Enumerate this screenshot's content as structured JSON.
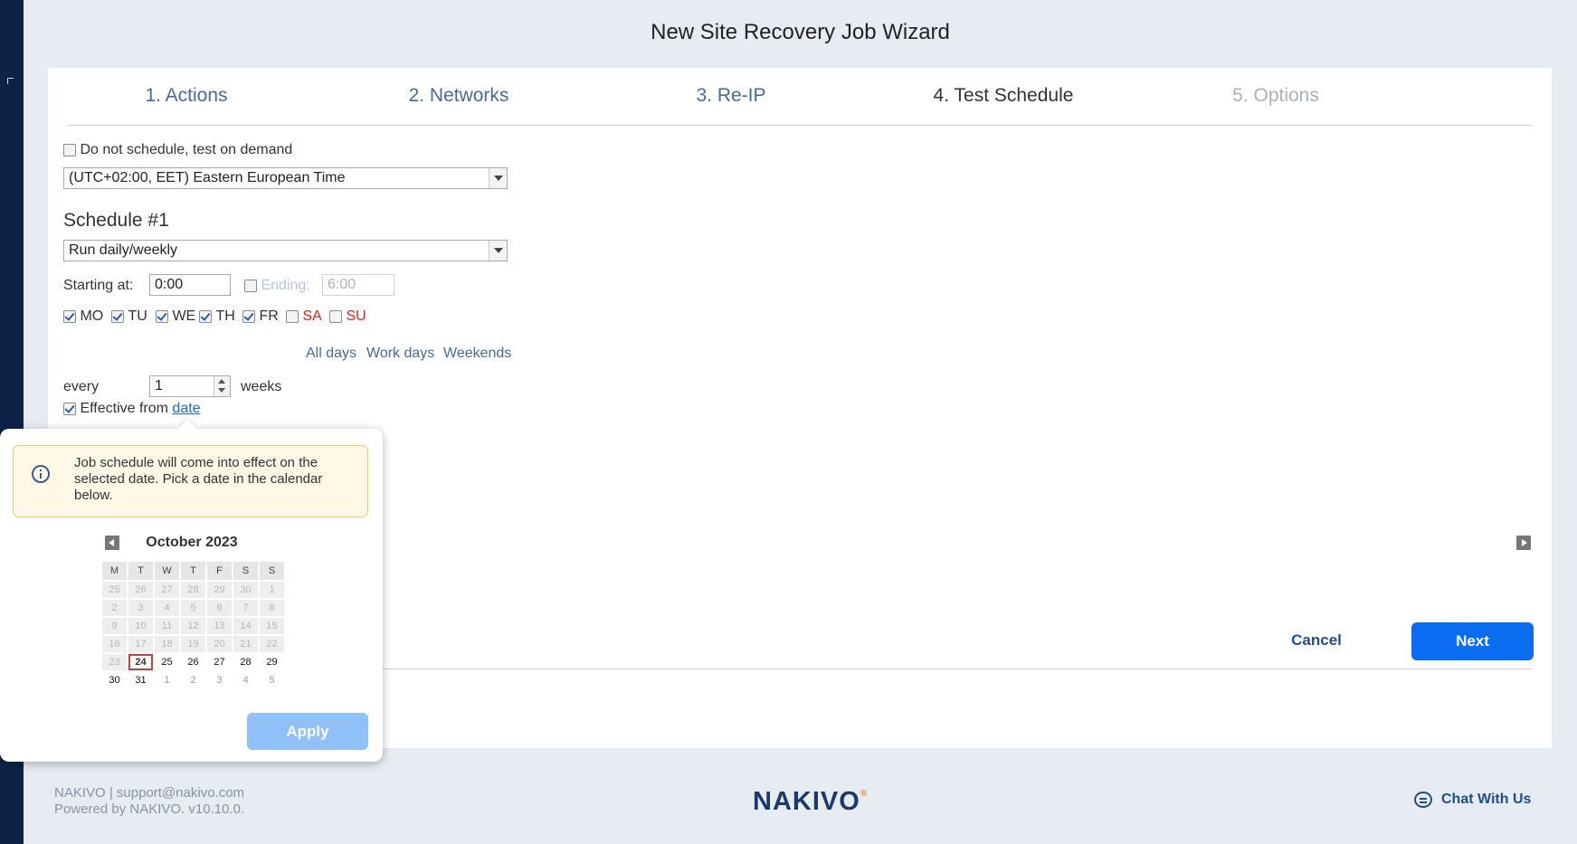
{
  "wizard": {
    "title": "New Site Recovery Job Wizard"
  },
  "steps": [
    {
      "label": "1. Actions",
      "state": "done"
    },
    {
      "label": "2. Networks",
      "state": "done"
    },
    {
      "label": "3. Re-IP",
      "state": "done"
    },
    {
      "label": "4. Test Schedule",
      "state": "active"
    },
    {
      "label": "5. Options",
      "state": "disabled"
    }
  ],
  "form": {
    "no_schedule_label": "Do not schedule, test on demand",
    "no_schedule_checked": false,
    "timezone": "(UTC+02:00, EET) Eastern European Time",
    "schedule_title": "Schedule #1",
    "schedule_type": "Run daily/weekly",
    "starting_label": "Starting at:",
    "starting_value": "0:00",
    "ending_label": "Ending:",
    "ending_value": "6:00",
    "ending_checked": false,
    "days": [
      {
        "label": "MO",
        "checked": true
      },
      {
        "label": "TU",
        "checked": true
      },
      {
        "label": "WE",
        "checked": true
      },
      {
        "label": "TH",
        "checked": true
      },
      {
        "label": "FR",
        "checked": true
      },
      {
        "label": "SA",
        "checked": false
      },
      {
        "label": "SU",
        "checked": false
      }
    ],
    "quick_links": {
      "all": "All days",
      "work": "Work days",
      "weekends": "Weekends"
    },
    "every_label": "every",
    "every_value": "1",
    "weeks_label": "weeks",
    "effective_label": "Effective from",
    "effective_link": "date",
    "effective_checked": true
  },
  "popup": {
    "info_text": "Job schedule will come into effect on the selected date. Pick a date in the calendar below.",
    "month": "October 2023",
    "weekdays": [
      "M",
      "T",
      "W",
      "T",
      "F",
      "S",
      "S"
    ],
    "weeks": [
      [
        "25",
        "26",
        "27",
        "28",
        "29",
        "30",
        "1"
      ],
      [
        "2",
        "3",
        "4",
        "5",
        "6",
        "7",
        "8"
      ],
      [
        "9",
        "10",
        "11",
        "12",
        "13",
        "14",
        "15"
      ],
      [
        "16",
        "17",
        "18",
        "19",
        "20",
        "21",
        "22"
      ],
      [
        "23",
        "24",
        "25",
        "26",
        "27",
        "28",
        "29"
      ],
      [
        "30",
        "31",
        "1",
        "2",
        "3",
        "4",
        "5"
      ]
    ],
    "today": "24",
    "apply_label": "Apply"
  },
  "actions": {
    "cancel": "Cancel",
    "next": "Next"
  },
  "footer": {
    "line1": "NAKIVO | support@nakivo.com",
    "line2": "Powered by NAKIVO. v10.10.0.",
    "logo": "NAKIVO",
    "logo_mark": "®",
    "chat": "Chat With Us"
  },
  "colors": {
    "primary": "#0a6cf0",
    "sidebar": "#0c2347",
    "link": "#4a6a94",
    "weekend": "#d12424",
    "apply_disabled": "#8fc0f7"
  }
}
